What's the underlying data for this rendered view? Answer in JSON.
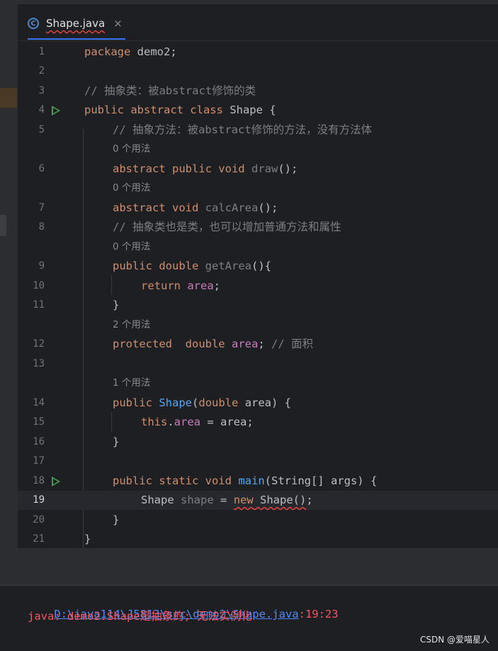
{
  "tab": {
    "file_name": "Shape.java",
    "icon": "java-class-icon",
    "close_glyph": "×"
  },
  "hints": {
    "h0": "0 个用法",
    "h2": "2 个用法",
    "h1": "1 个用法"
  },
  "lines": {
    "n1": "1",
    "n2": "2",
    "n3": "3",
    "n4": "4",
    "n5": "5",
    "n6": "6",
    "n7": "7",
    "n8": "8",
    "n9": "9",
    "n10": "10",
    "n11": "11",
    "n12": "12",
    "n13": "13",
    "n14": "14",
    "n15": "15",
    "n16": "16",
    "n17": "17",
    "n18": "18",
    "n19": "19",
    "n20": "20",
    "n21": "21"
  },
  "code": {
    "package_kw": "package",
    "package_name": " demo2;",
    "comment3": "// 抽象类：被abstract修饰的类",
    "l4_kw": "public abstract class",
    "l4_rest": " Shape {",
    "comment5": "// 抽象方法：被abstract修饰的方法，没有方法体",
    "l6_kw": "abstract public void",
    "l6_fn": "draw",
    "l6_rest": "();",
    "l7_kw": "abstract void",
    "l7_fn": "calcArea",
    "l7_rest": "();",
    "comment8": "// 抽象类也是类，也可以增加普通方法和属性",
    "l9_kw": "public double",
    "l9_fn": "getArea",
    "l9_rest": "(){",
    "l10_kw": "return",
    "l10_fld": "area",
    "l10_rest": ";",
    "brace": "}",
    "l12_kw": "protected  double",
    "l12_fld": "area",
    "l12_rest": "; ",
    "l12_cm": "// 面积",
    "l14_kw": "public",
    "l14_fn": "Shape",
    "l14_p1": "(",
    "l14_kw2": "double",
    "l14_rest": " area) {",
    "l15_kw": "this",
    "l15_dot": ".",
    "l15_fld": "area",
    "l15_rest": " = area;",
    "l18_kw": "public static void",
    "l18_fn": "main",
    "l18_rest": "(String[] args) {",
    "l19_type": "Shape",
    "l19_var": "shape",
    "l19_eq": " = ",
    "l19_new": "new",
    "l19_ctor": " Shape()",
    "l19_semi": ";"
  },
  "output": {
    "path": "D:\\java114\\J5813\\src\\demo2\\Shape.java",
    "position": ":19:23",
    "error": "java: demo2.Shape是抽象的; 无法实例化"
  },
  "watermark": "CSDN @爱喵星人"
}
